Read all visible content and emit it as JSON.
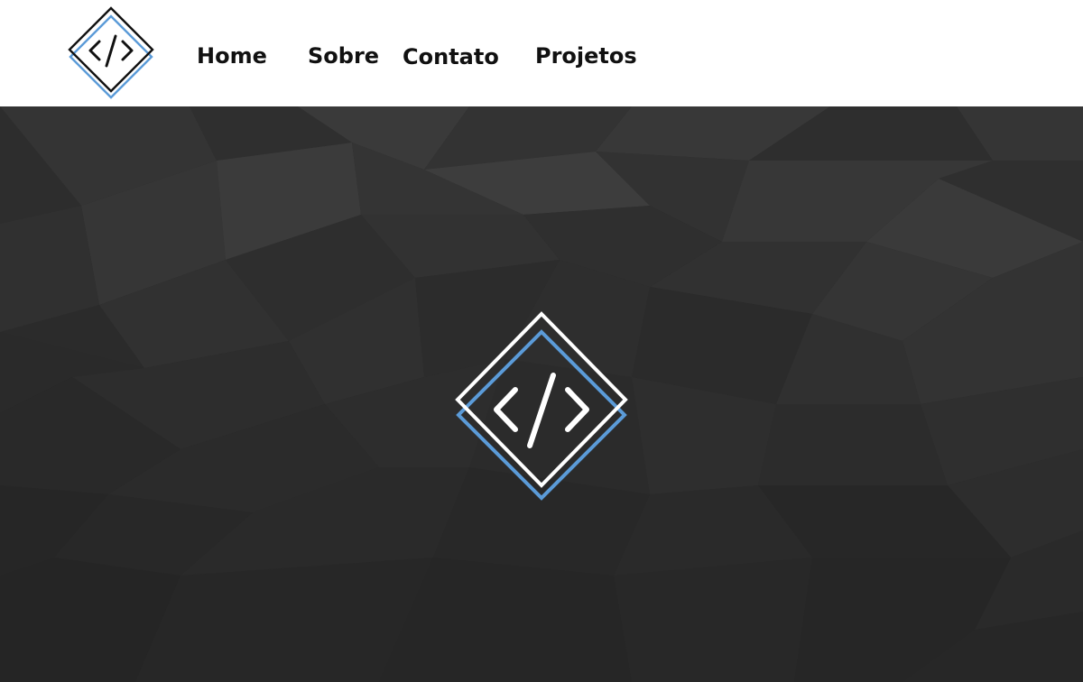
{
  "header": {
    "logo_icon": "code-brackets-diamond-icon",
    "nav": {
      "home": "Home",
      "sobre": "Sobre",
      "contato": "Contato",
      "projetos": "Projetos"
    }
  },
  "hero": {
    "background": "dark-low-poly-pattern",
    "logo_icon": "code-brackets-diamond-icon"
  },
  "colors": {
    "header_bg": "#ffffff",
    "nav_text": "#111111",
    "hero_bg": "#2b2b2b",
    "accent_blue": "#5b9bd8",
    "logo_dark": "#111111",
    "logo_light": "#ffffff"
  }
}
